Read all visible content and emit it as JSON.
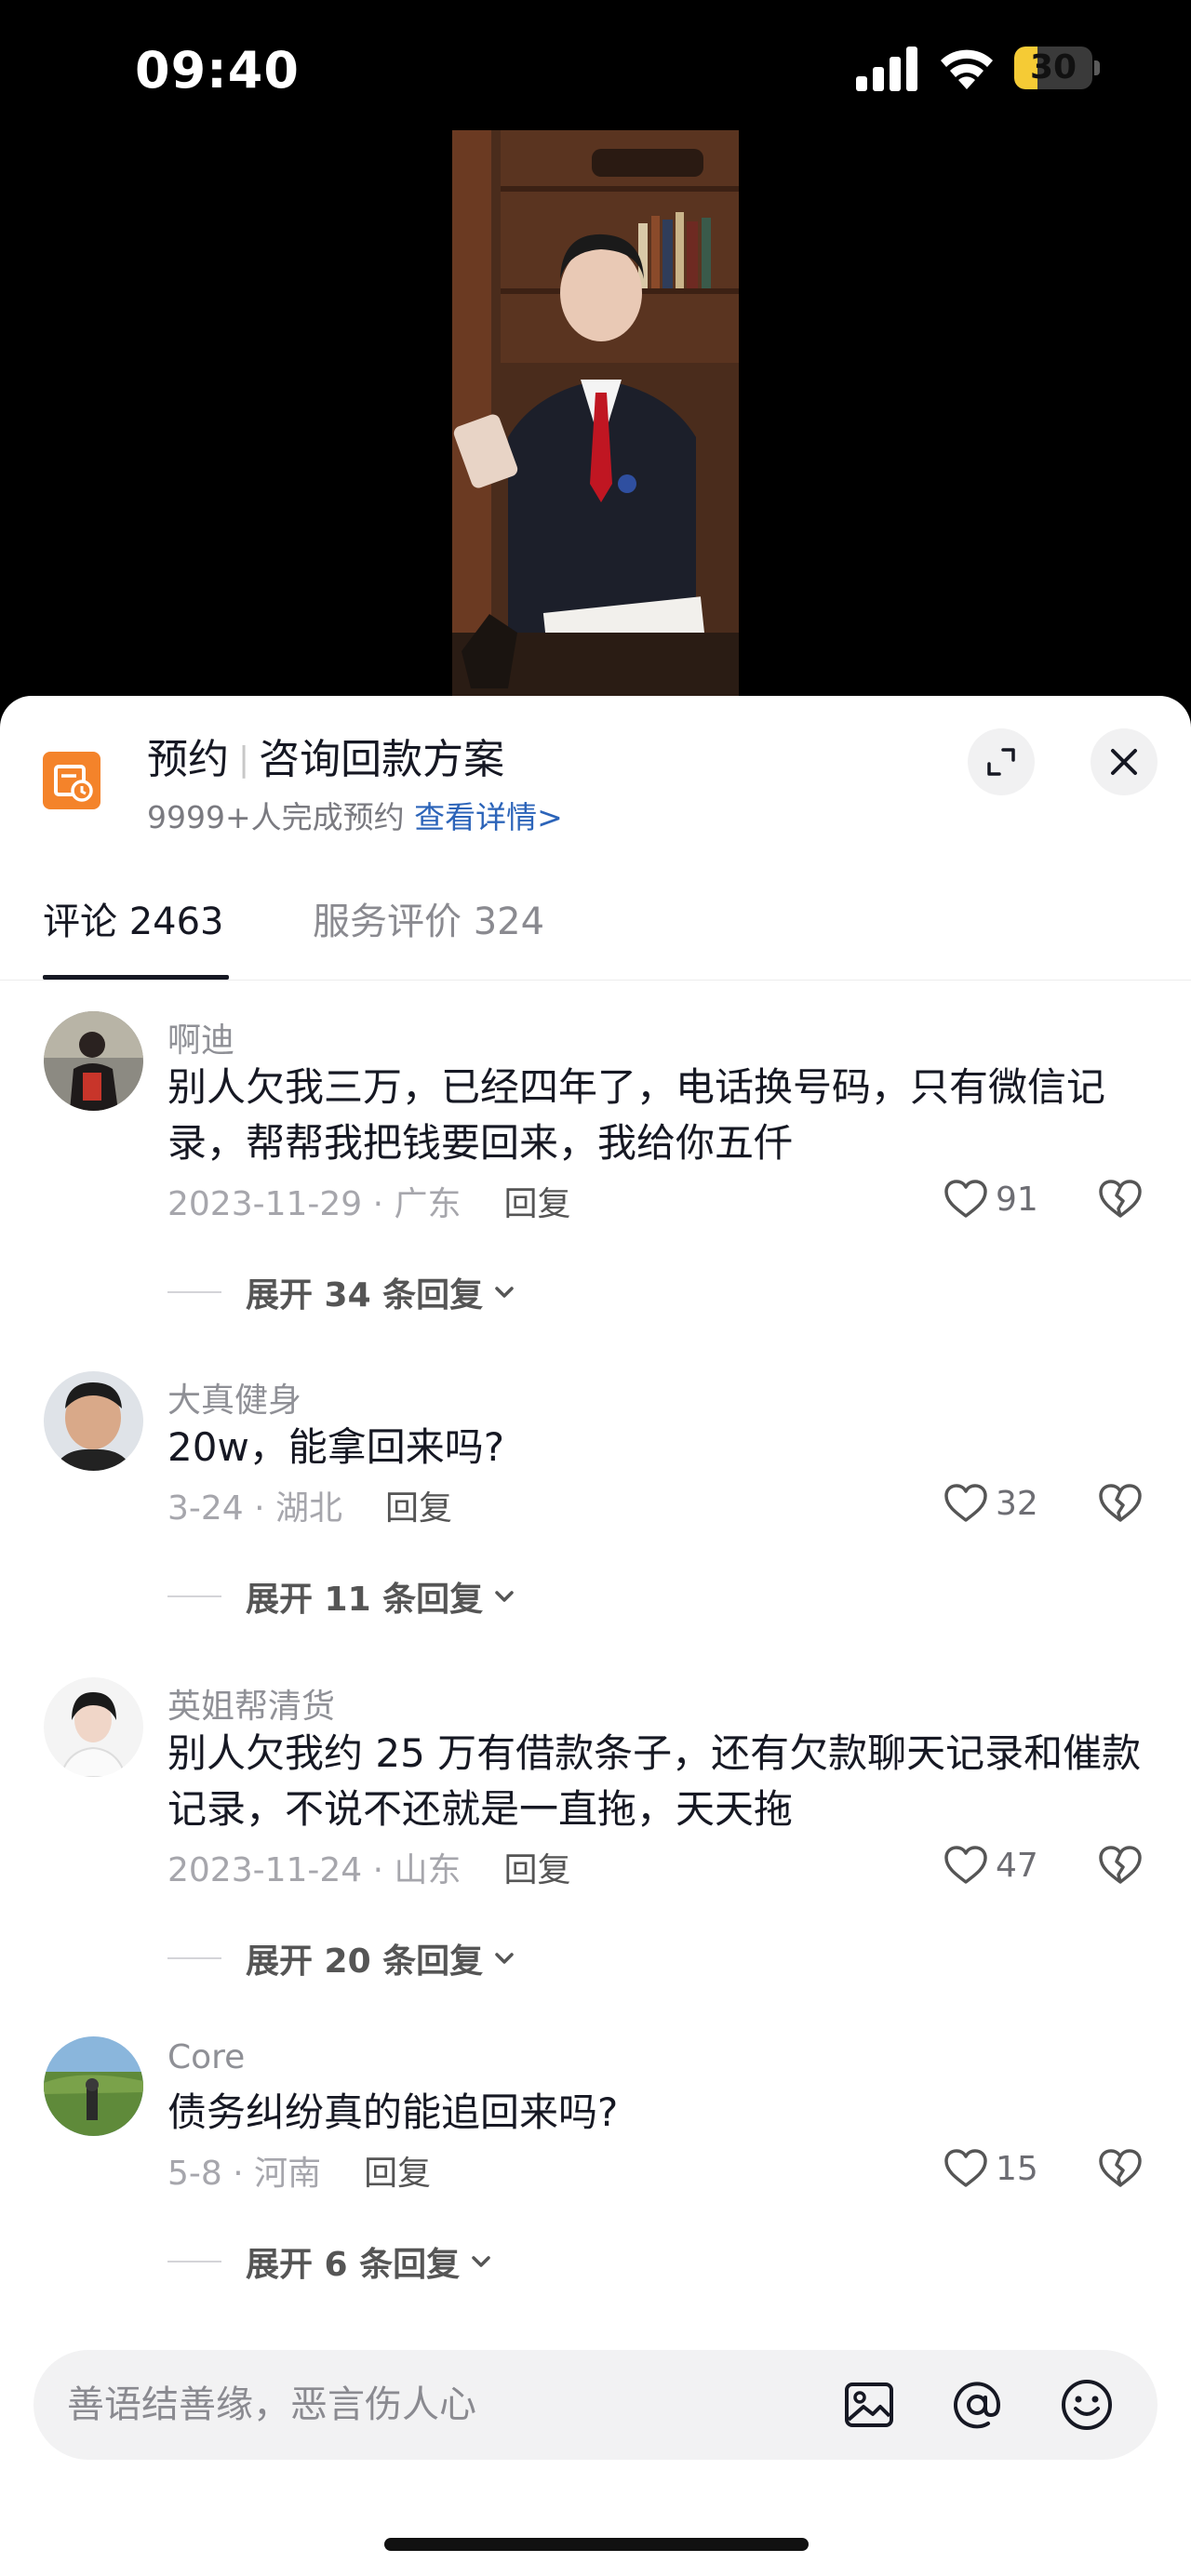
{
  "status_bar": {
    "time": "09:40",
    "battery_level": "30",
    "battery_fraction": 0.3
  },
  "promo": {
    "title_a": "预约",
    "title_b": "咨询回款方案",
    "subtitle": "9999+人完成预约",
    "link": "查看详情>"
  },
  "tabs": [
    {
      "label": "评论 2463"
    },
    {
      "label": "服务评价 324"
    }
  ],
  "comments": [
    {
      "user": "啊迪",
      "text": "别人欠我三万，已经四年了，电话换号码，只有微信记录，帮帮我把钱要回来，我给你五仟",
      "date_location": "2023-11-29 · 广东",
      "reply_label": "回复",
      "likes": "91",
      "expand": "展开 34 条回复"
    },
    {
      "user": "大真健身",
      "text": "20w，能拿回来吗?",
      "date_location": "3-24 · 湖北",
      "reply_label": "回复",
      "likes": "32",
      "expand": "展开 11 条回复"
    },
    {
      "user": "英姐帮清货",
      "text": "别人欠我约 25 万有借款条子，还有欠款聊天记录和催款记录，不说不还就是一直拖，天天拖",
      "date_location": "2023-11-24 · 山东",
      "reply_label": "回复",
      "likes": "47",
      "expand": "展开 20 条回复"
    },
    {
      "user": "Core",
      "text": "债务纠纷真的能追回来吗?",
      "date_location": "5-8 · 河南",
      "reply_label": "回复",
      "likes": "15",
      "expand": "展开 6 条回复"
    }
  ],
  "input": {
    "placeholder": "善语结善缘，恶言伤人心"
  },
  "icons": {
    "promo": "calendar-clock-icon",
    "expand": "expand-icon",
    "close": "close-icon",
    "like": "heart-icon",
    "dislike": "broken-heart-icon",
    "image": "image-icon",
    "mention": "at-icon",
    "emoji": "emoji-icon"
  },
  "colors": {
    "promo_accent": "#f4832a",
    "link": "#2c64b9",
    "battery": "#f5cb35"
  }
}
